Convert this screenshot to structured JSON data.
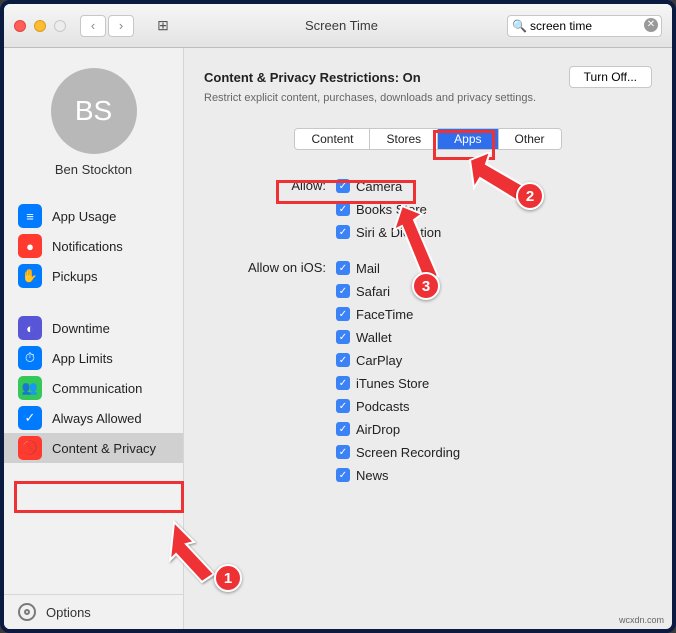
{
  "window": {
    "title": "Screen Time"
  },
  "search": {
    "value": "screen time",
    "placeholder": "Search"
  },
  "user": {
    "initials": "BS",
    "name": "Ben Stockton"
  },
  "sidebar": {
    "group1": [
      {
        "label": "App Usage",
        "color": "blue",
        "glyph": "≡"
      },
      {
        "label": "Notifications",
        "color": "orange",
        "glyph": "●"
      },
      {
        "label": "Pickups",
        "color": "blue",
        "glyph": "✋"
      }
    ],
    "group2": [
      {
        "label": "Downtime",
        "color": "purple",
        "glyph": "◐"
      },
      {
        "label": "App Limits",
        "color": "blue",
        "glyph": "⏱"
      },
      {
        "label": "Communication",
        "color": "green",
        "glyph": "👥"
      },
      {
        "label": "Always Allowed",
        "color": "blue",
        "glyph": "✓"
      },
      {
        "label": "Content & Privacy",
        "color": "red2",
        "glyph": "🚫"
      }
    ],
    "options": "Options"
  },
  "header": {
    "title_prefix": "Content & Privacy Restrictions: ",
    "title_state": "On",
    "desc": "Restrict explicit content, purchases, downloads and privacy settings.",
    "turn_off": "Turn Off..."
  },
  "tabs": {
    "t0": "Content",
    "t1": "Stores",
    "t2": "Apps",
    "t3": "Other"
  },
  "allow": {
    "label": "Allow:",
    "items": [
      {
        "label": "Camera"
      },
      {
        "label": "Books Store"
      },
      {
        "label": "Siri & Dictation"
      }
    ]
  },
  "allow_ios": {
    "label": "Allow on iOS:",
    "items": [
      {
        "label": "Mail"
      },
      {
        "label": "Safari"
      },
      {
        "label": "FaceTime"
      },
      {
        "label": "Wallet"
      },
      {
        "label": "CarPlay"
      },
      {
        "label": "iTunes Store"
      },
      {
        "label": "Podcasts"
      },
      {
        "label": "AirDrop"
      },
      {
        "label": "Screen Recording"
      },
      {
        "label": "News"
      }
    ]
  },
  "annotations": {
    "n1": "1",
    "n2": "2",
    "n3": "3"
  },
  "watermark": "wcxdn.com"
}
